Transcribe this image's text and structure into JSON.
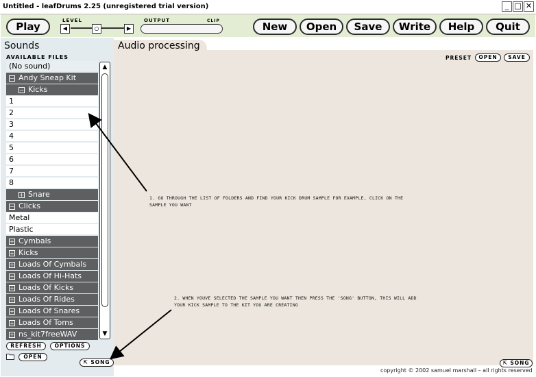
{
  "window": {
    "title": "Untitled - leafDrums 2.25 (unregistered trial version)",
    "minimize": "_",
    "maximize": "□",
    "close": "✕"
  },
  "toolbar": {
    "play": "Play",
    "level_label": "LEVEL",
    "level_left": "◀",
    "level_mid": "○",
    "level_right": "▶",
    "output_label": "OUTPUT",
    "clip_label": "CLIP",
    "new": "New",
    "open": "Open",
    "save": "Save",
    "write": "Write",
    "help": "Help",
    "quit": "Quit"
  },
  "sidebar": {
    "tab": "Sounds",
    "header": "AVAILABLE FILES",
    "items": [
      {
        "label": "(No sound)",
        "kind": "nosound",
        "indent": 0,
        "exp": ""
      },
      {
        "label": "Andy Sneap Kit",
        "kind": "folder",
        "indent": 0,
        "exp": "−"
      },
      {
        "label": "Kicks",
        "kind": "folder",
        "indent": 1,
        "exp": "−"
      },
      {
        "label": "1",
        "kind": "item",
        "indent": 0,
        "exp": ""
      },
      {
        "label": "2",
        "kind": "item",
        "indent": 0,
        "exp": ""
      },
      {
        "label": "3",
        "kind": "item",
        "indent": 0,
        "exp": ""
      },
      {
        "label": "4",
        "kind": "item",
        "indent": 0,
        "exp": ""
      },
      {
        "label": "5",
        "kind": "item",
        "indent": 0,
        "exp": ""
      },
      {
        "label": "6",
        "kind": "item",
        "indent": 0,
        "exp": ""
      },
      {
        "label": "7",
        "kind": "item",
        "indent": 0,
        "exp": ""
      },
      {
        "label": "8",
        "kind": "item",
        "indent": 0,
        "exp": ""
      },
      {
        "label": "Snare",
        "kind": "folder",
        "indent": 1,
        "exp": "+"
      },
      {
        "label": "Clicks",
        "kind": "folder",
        "indent": 0,
        "exp": "−"
      },
      {
        "label": "Metal",
        "kind": "item",
        "indent": 0,
        "exp": ""
      },
      {
        "label": "Plastic",
        "kind": "item",
        "indent": 0,
        "exp": ""
      },
      {
        "label": "Cymbals",
        "kind": "folder",
        "indent": 0,
        "exp": "+"
      },
      {
        "label": "Kicks",
        "kind": "folder",
        "indent": 0,
        "exp": "+"
      },
      {
        "label": "Loads Of Cymbals",
        "kind": "folder",
        "indent": 0,
        "exp": "+"
      },
      {
        "label": "Loads Of Hi-Hats",
        "kind": "folder",
        "indent": 0,
        "exp": "+"
      },
      {
        "label": "Loads Of Kicks",
        "kind": "folder",
        "indent": 0,
        "exp": "+"
      },
      {
        "label": "Loads Of Rides",
        "kind": "folder",
        "indent": 0,
        "exp": "+"
      },
      {
        "label": "Loads Of Snares",
        "kind": "folder",
        "indent": 0,
        "exp": "+"
      },
      {
        "label": "Loads Of Toms",
        "kind": "folder",
        "indent": 0,
        "exp": "+"
      },
      {
        "label": "ns_kit7freeWAV",
        "kind": "folder",
        "indent": 0,
        "exp": "+"
      }
    ],
    "scroll_up": "▲",
    "scroll_down": "▼",
    "refresh": "REFRESH",
    "options": "OPTIONS",
    "open": "OPEN",
    "song": "⇱ SONG"
  },
  "main": {
    "tab": "Audio processing",
    "preset_label": "PRESET",
    "preset_open": "OPEN",
    "preset_save": "SAVE",
    "note1_line1": "1. GO THROUGH THE LIST OF FOLDERS AND FIND YOUR KICK DRUM SAMPLE FOR EXAMPLE, CLICK ON THE",
    "note1_line2": "SAMPLE YOU WANT",
    "note2_line1": "2. WHEN YOUVE SELECTED THE SAMPLE YOU WANT THEN PRESS THE 'SONG' BUTTON, THIS WILL ADD",
    "note2_line2": "YOUR KICK SAMPLE TO THE KIT YOU ARE CREATING",
    "song": "⇱ SONG",
    "copyright": "copyright © 2002 samuel marshall – all rights reserved"
  }
}
